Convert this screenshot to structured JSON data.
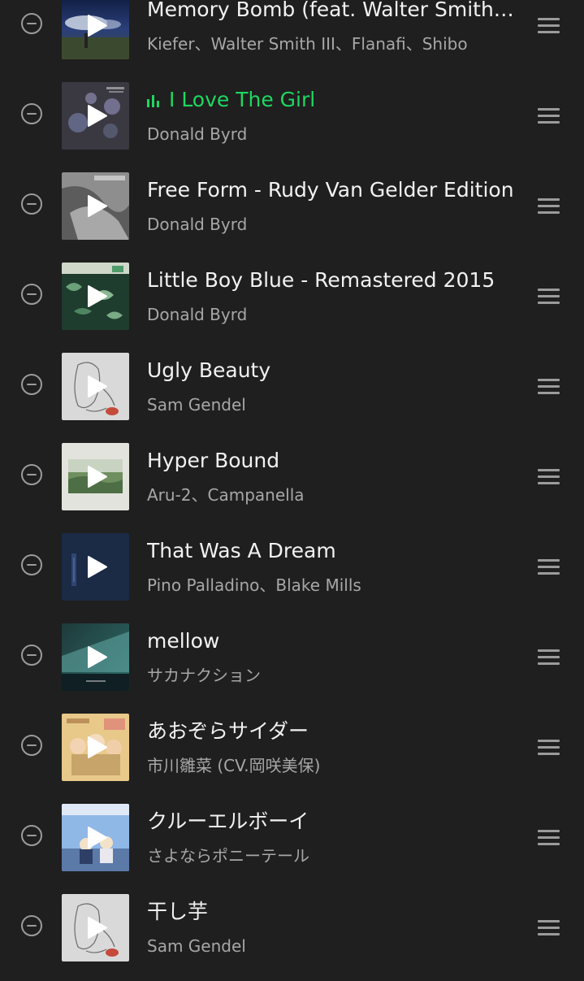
{
  "queue": {
    "tracks": [
      {
        "title": "Memory Bomb (feat. Walter Smith III) [Remix]",
        "artist": "Kiefer、Walter Smith III、Flanafi、Shibo",
        "playing": false,
        "art": "night-sky-figure"
      },
      {
        "title": "I Love The Girl",
        "artist": "Donald Byrd",
        "playing": true,
        "art": "bokeh-lights"
      },
      {
        "title": "Free Form - Rudy Van Gelder Edition",
        "artist": "Donald Byrd",
        "playing": false,
        "art": "monochrome-photo"
      },
      {
        "title": "Little Boy Blue - Remastered 2015",
        "artist": "Donald Byrd",
        "playing": false,
        "art": "green-foliage"
      },
      {
        "title": "Ugly Beauty",
        "artist": "Sam Gendel",
        "playing": false,
        "art": "line-drawing"
      },
      {
        "title": "Hyper Bound",
        "artist": "Aru-2、Campanella",
        "playing": false,
        "art": "landscape-frame"
      },
      {
        "title": "That Was A Dream",
        "artist": "Pino Palladino、Blake Mills",
        "playing": false,
        "art": "dark-blue"
      },
      {
        "title": "mellow",
        "artist": "サカナクション",
        "playing": false,
        "art": "teal-sea"
      },
      {
        "title": "あおぞらサイダー",
        "artist": "市川雛菜 (CV.岡咲美保)",
        "playing": false,
        "art": "anime-group"
      },
      {
        "title": "クルーエルボーイ",
        "artist": "さよならポニーテール",
        "playing": false,
        "art": "anime-sky"
      },
      {
        "title": "干し芋",
        "artist": "Sam Gendel",
        "playing": false,
        "art": "line-drawing"
      }
    ]
  },
  "icons": {
    "remove": "minus-circle-icon",
    "play": "play-icon",
    "now_playing": "equalizer-icon",
    "drag": "drag-handle-icon"
  },
  "colors": {
    "background": "#1f1f1f",
    "accent_playing": "#1ed760",
    "title_text": "#f2f2f2",
    "subtitle_text": "#a7a7a7"
  }
}
